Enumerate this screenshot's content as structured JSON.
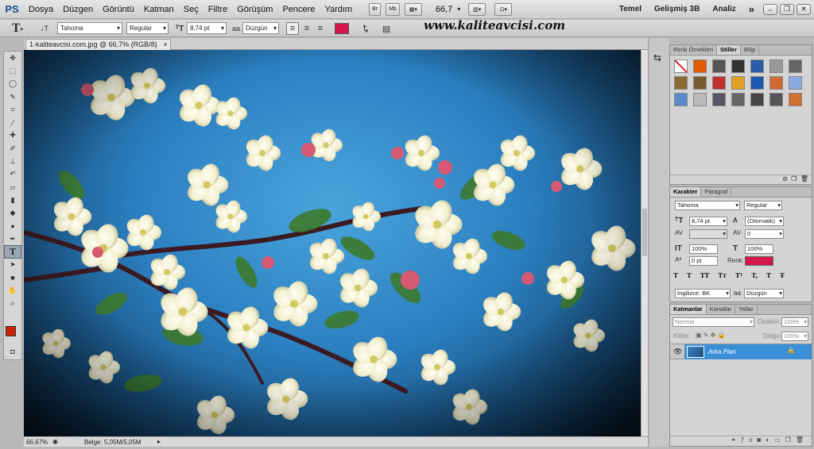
{
  "app": {
    "logo": "PS",
    "menu": [
      "Dosya",
      "Düzgen",
      "Görüntü",
      "Katman",
      "Seç",
      "Filtre",
      "Görüşüm",
      "Pencere",
      "Yardım"
    ],
    "bridge_button": "Br",
    "minibridge_button": "Mb",
    "zoom_value": "66,7",
    "workspaces": [
      "Temel",
      "Gelişmiş 3B",
      "Analiz"
    ],
    "more": "»"
  },
  "options": {
    "font_family": "Tahoma",
    "font_style": "Regular",
    "font_size": "8,74 pt",
    "antialias_label": "aa",
    "antialias": "Düzgün",
    "text_color": "#d6174e",
    "watermark": "www.kaliteavcisi.com"
  },
  "document": {
    "tab_title": "1-kaliteavcisi.com.jpg @ 66,7% (RGB/8)",
    "zoom": "66,67%",
    "doc_info": "Belge: 5,05M/5,05M"
  },
  "tools": [
    "move-icon",
    "marquee-icon",
    "lasso-icon",
    "quick-select-icon",
    "crop-icon",
    "eyedropper-icon",
    "healing-icon",
    "brush-icon",
    "stamp-icon",
    "history-brush-icon",
    "eraser-icon",
    "gradient-icon",
    "blur-icon",
    "dodge-icon",
    "pen-icon",
    "type-icon",
    "path-select-icon",
    "shape-icon",
    "hand-icon",
    "zoom-icon"
  ],
  "foreground_color": "#cc2200",
  "styles_panel": {
    "tabs": [
      "Renk Örnekleri",
      "Stiller",
      "Bilgi"
    ],
    "active_tab": "Stiller"
  },
  "character_panel": {
    "tabs": [
      "Karakter",
      "Paragraf"
    ],
    "font_family": "Tahoma",
    "font_style": "Regular",
    "font_size": "8,74 pt",
    "leading": "(Otomatik)",
    "tracking": "0",
    "vertical_scale": "100%",
    "horizontal_scale": "100%",
    "baseline_shift": "0 pt",
    "color_label": "Renk:",
    "color": "#d6174e",
    "type_buttons": [
      "T",
      "T",
      "TT",
      "Tт",
      "T¹",
      "T,",
      "T",
      "T̶"
    ],
    "language": "İngilizce: BK",
    "antialias_label": "aa",
    "antialias": "Düzgün"
  },
  "layers_panel": {
    "tabs": [
      "Katmanlar",
      "Kanallar",
      "Yollar"
    ],
    "blend_mode": "Normal",
    "opacity_label": "Opaklık:",
    "opacity": "100%",
    "lock_label": "Kilitle:",
    "fill_label": "Dolgu:",
    "fill": "100%",
    "layers": [
      {
        "name": "Arka Plan"
      }
    ]
  }
}
